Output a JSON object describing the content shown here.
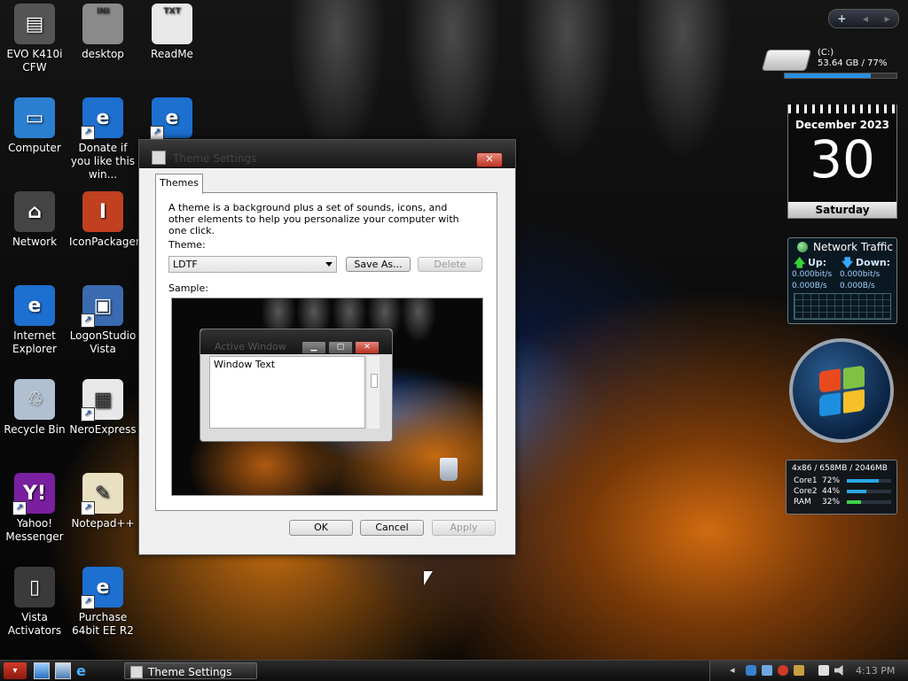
{
  "desktop_icons": [
    {
      "label": "EVO K410i CFW",
      "icon": "printer-icon",
      "shortcut": false
    },
    {
      "label": "desktop",
      "icon": "ini-file-icon",
      "badge": "INI",
      "shortcut": false
    },
    {
      "label": "ReadMe",
      "icon": "txt-file-icon",
      "badge": "TXT",
      "shortcut": false
    },
    {
      "label": "Computer",
      "icon": "computer-icon",
      "shortcut": false
    },
    {
      "label": "Donate if you like this win...",
      "icon": "internet-explorer-icon",
      "shortcut": true
    },
    {
      "label": "",
      "icon": "internet-explorer-icon",
      "shortcut": true
    },
    {
      "label": "Network",
      "icon": "network-icon",
      "shortcut": false
    },
    {
      "label": "IconPackager",
      "icon": "iconpackager-icon",
      "shortcut": false
    },
    {
      "label": "Internet Explorer",
      "icon": "internet-explorer-icon",
      "shortcut": false
    },
    {
      "label": "LogonStudio Vista",
      "icon": "logonstudio-icon",
      "shortcut": true
    },
    {
      "label": "Recycle Bin",
      "icon": "recycle-bin-icon",
      "shortcut": false
    },
    {
      "label": "NeroExpress",
      "icon": "nero-icon",
      "shortcut": true
    },
    {
      "label": "Yahoo! Messenger",
      "icon": "yahoo-messenger-icon",
      "shortcut": true
    },
    {
      "label": "Notepad++",
      "icon": "notepad-icon",
      "shortcut": true
    },
    {
      "label": "Vista Activators",
      "icon": "folder-icon",
      "shortcut": false
    },
    {
      "label": "Purchase 64bit EE R2",
      "icon": "internet-explorer-icon",
      "shortcut": true
    }
  ],
  "dialog": {
    "title": "Theme Settings",
    "close_label": "✕",
    "tab_label": "Themes",
    "description": "A theme is a background plus a set of sounds, icons, and other elements to help you personalize your computer with one click.",
    "theme_label": "Theme:",
    "theme_value": "LDTF",
    "save_as_label": "Save As...",
    "delete_label": "Delete",
    "sample_label": "Sample:",
    "sample": {
      "window_title": "Active Window",
      "window_text": "Window Text",
      "min_label": "▁",
      "max_label": "▢",
      "close_label": "✕"
    },
    "ok_label": "OK",
    "cancel_label": "Cancel",
    "apply_label": "Apply"
  },
  "drive_gadget": {
    "drive": "(C:)",
    "info": "53.64 GB / 77%",
    "used_percent": 77
  },
  "calendar_gadget": {
    "month_year": "December 2023",
    "day": "30",
    "weekday": "Saturday"
  },
  "network_gadget": {
    "title": "Network Traffic",
    "up_label": "Up:",
    "down_label": "Down:",
    "up_bits": "0.000bit/s",
    "down_bits": "0.000bit/s",
    "up_bytes": "0.000B/s",
    "down_bytes": "0.000B/s"
  },
  "cpu_gadget": {
    "header": "4x86 / 658MB / 2046MB",
    "rows": [
      {
        "label": "Core1",
        "value": "72%",
        "percent": 72,
        "color": "#2aa7e6"
      },
      {
        "label": "Core2",
        "value": "44%",
        "percent": 44,
        "color": "#2aa7e6"
      },
      {
        "label": "RAM",
        "value": "32%",
        "percent": 32,
        "color": "#3fd04a"
      }
    ]
  },
  "top_toolbar": {
    "plus_label": "+",
    "prev_label": "◂",
    "next_label": "▸"
  },
  "taskbar": {
    "active_task": "Theme Settings",
    "clock": "4:13 PM"
  },
  "colors": {
    "accent_blue": "#1d5fc2",
    "close_red": "#c03523",
    "gadget_border": "#6a6a6a"
  }
}
